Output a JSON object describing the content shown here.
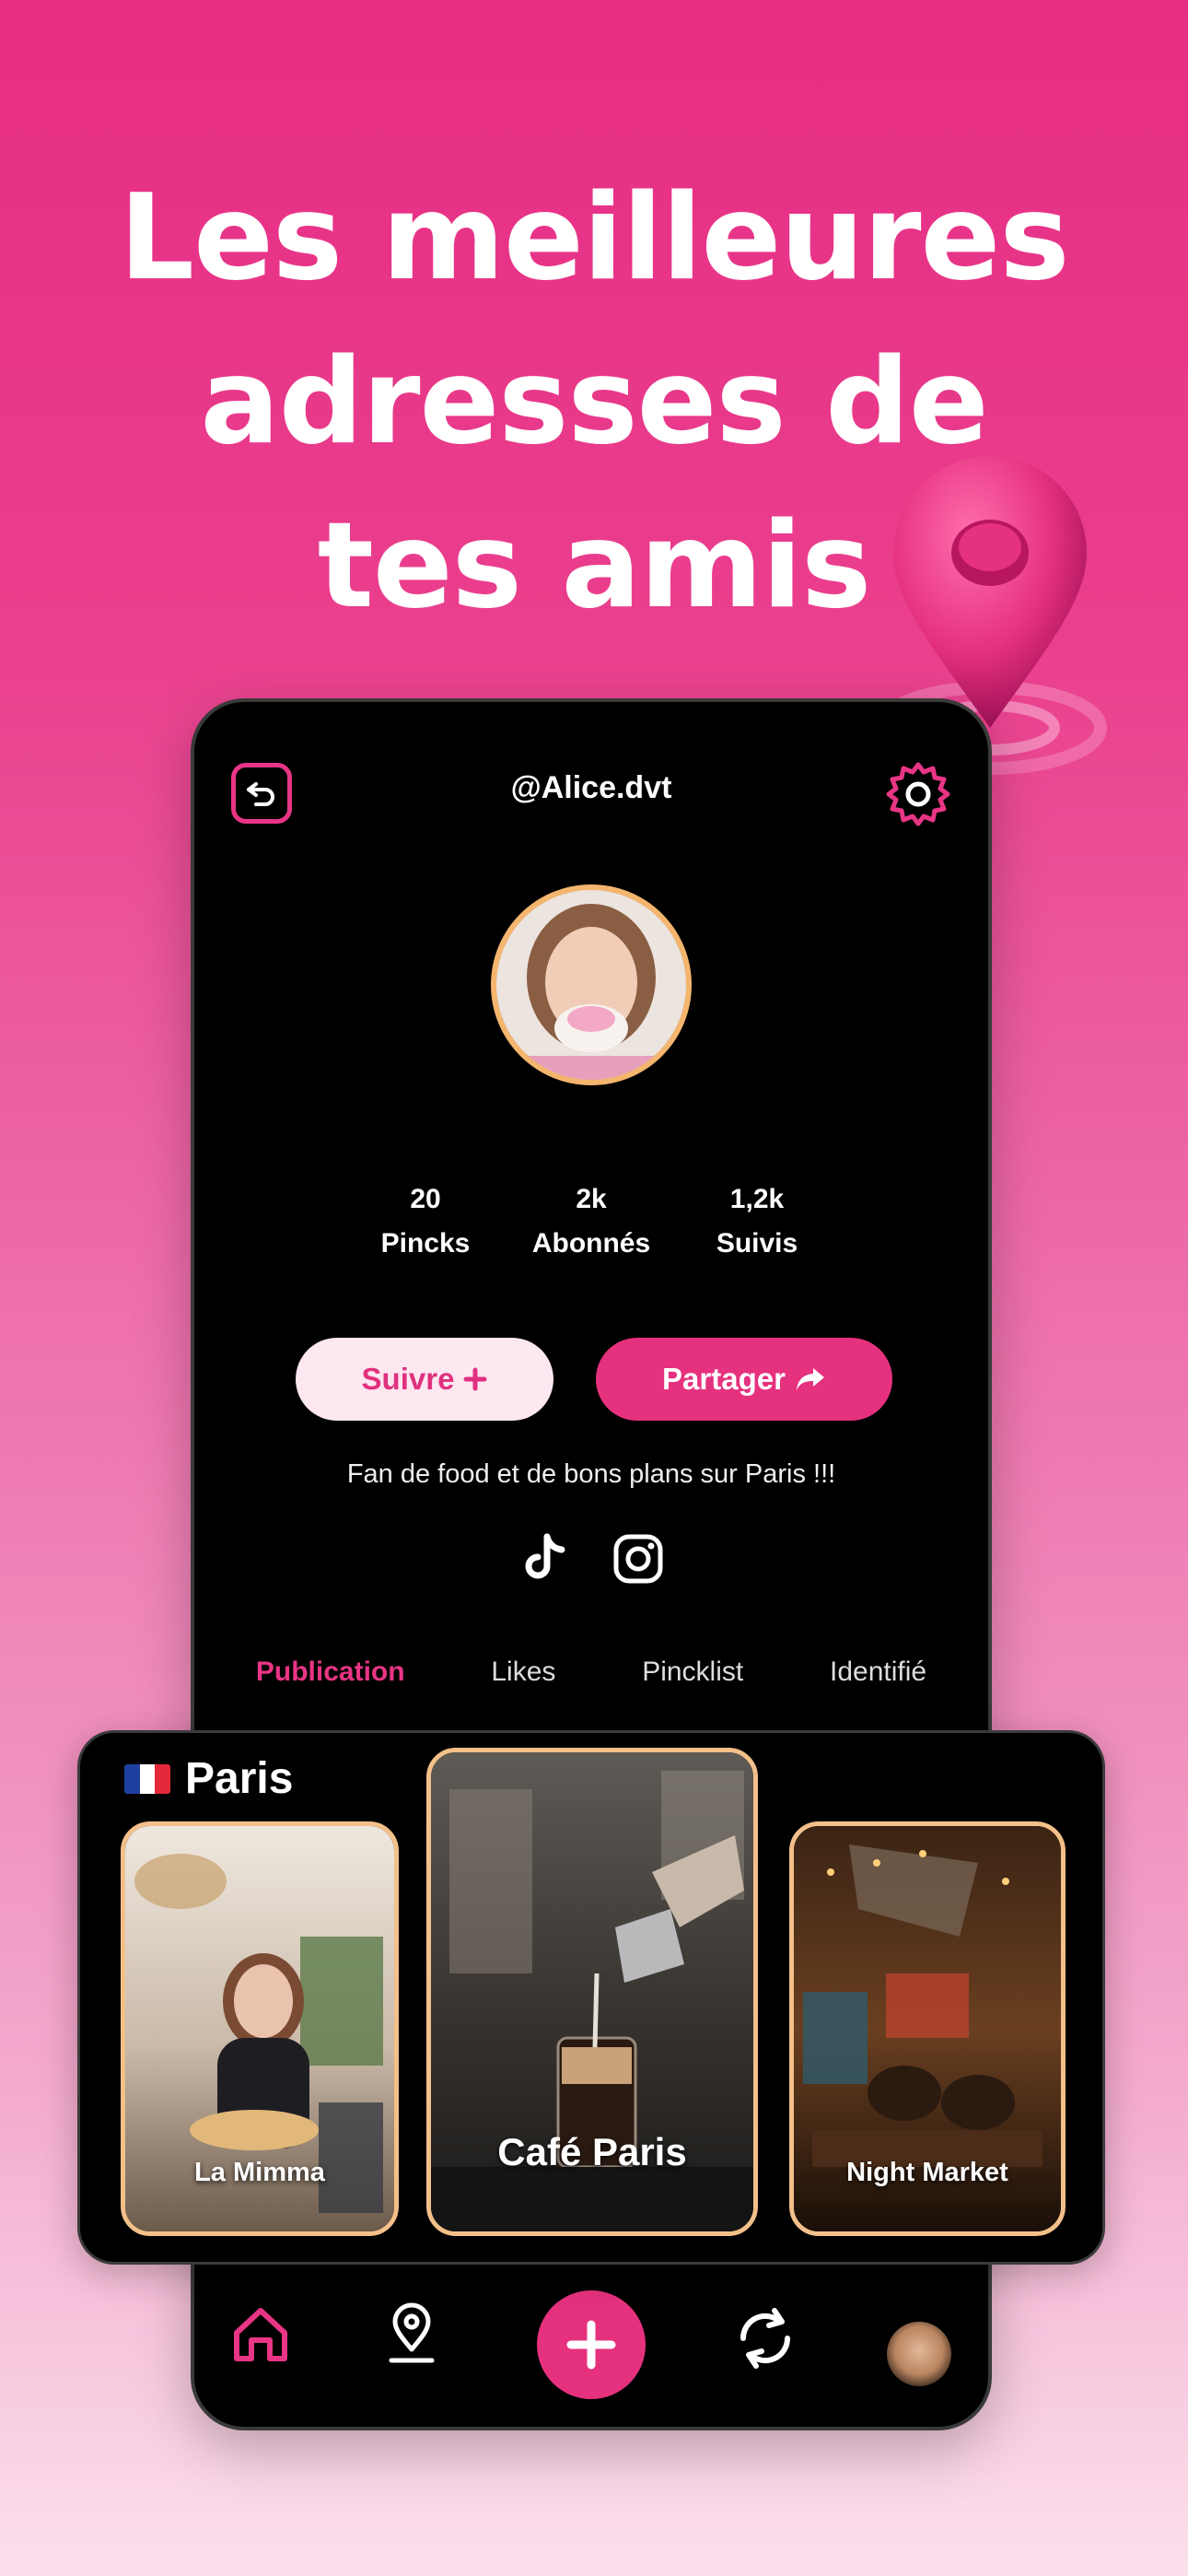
{
  "headline": {
    "line1": "Les meilleures",
    "line2": "adresses de",
    "line3": "tes amis"
  },
  "profile": {
    "username": "@Alice.dvt",
    "stats": [
      {
        "value": "20",
        "label": "Pincks"
      },
      {
        "value": "2k",
        "label": "Abonnés"
      },
      {
        "value": "1,2k",
        "label": "Suivis"
      }
    ],
    "follow_label": "Suivre",
    "share_label": "Partager",
    "bio": "Fan de food et de bons plans sur Paris !!!",
    "tabs": [
      "Publication",
      "Likes",
      "Pincklist",
      "Identifié"
    ]
  },
  "places": {
    "city": "Paris",
    "items": [
      {
        "name": "La Mimma"
      },
      {
        "name": "Café Paris"
      },
      {
        "name": "Night Market"
      }
    ]
  },
  "colors": {
    "accent": "#e6317f",
    "card_border": "#f3c08a",
    "background_top": "#e62d84"
  }
}
